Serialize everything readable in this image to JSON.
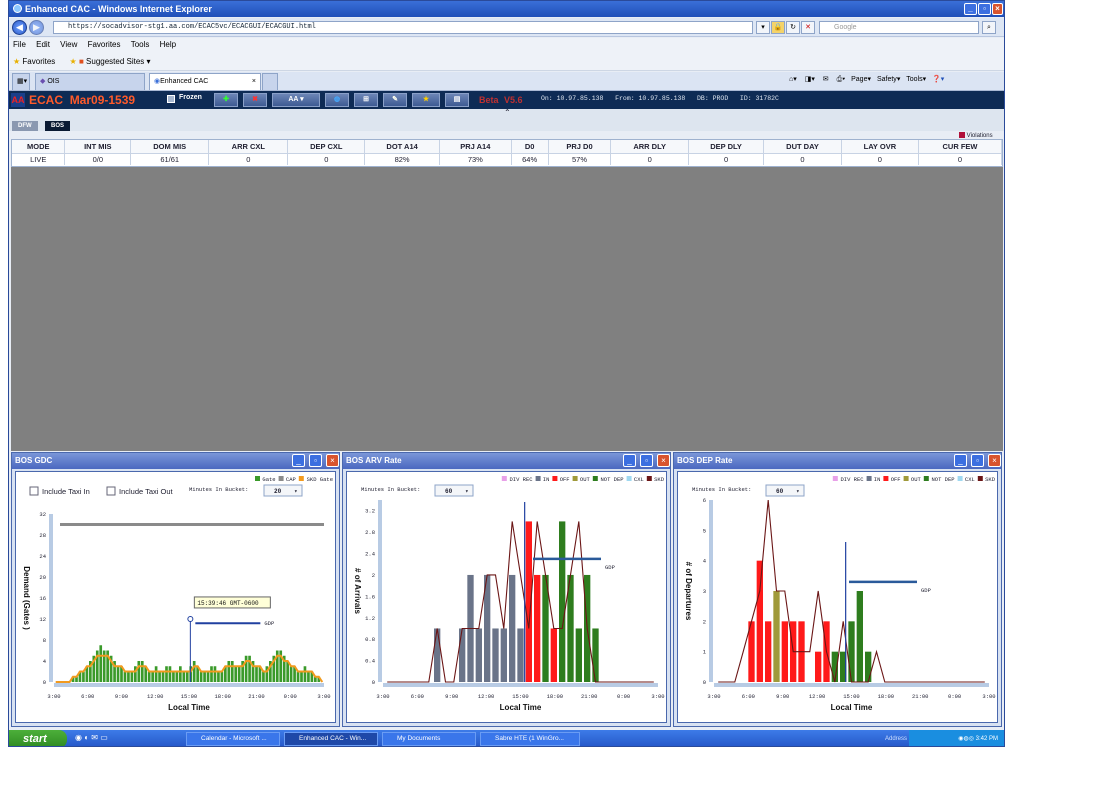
{
  "window": {
    "title": "Enhanced CAC - Windows Internet Explorer"
  },
  "browser": {
    "url": "https://socadvisor-stg1.aa.com/ECAC5vc/ECACGUI/ECACGUI.html",
    "search_placeholder": "Google",
    "menu": [
      "File",
      "Edit",
      "View",
      "Favorites",
      "Tools",
      "Help"
    ],
    "favorites_label": "Favorites",
    "suggested_sites_label": "Suggested Sites",
    "tabs": [
      "OIS",
      "Enhanced CAC"
    ],
    "toolbar": {
      "page": "Page",
      "safety": "Safety",
      "tools": "Tools"
    }
  },
  "app": {
    "name": "ECAC",
    "session": "Mar09-1539",
    "frozen_label": "Frozen",
    "filter_label": "AA",
    "beta_label": "Beta",
    "version": "V5.6",
    "status": "On: 10.97.85.138   From: 10.97.85.138   DB: PROD   ID: 31782C",
    "sites": [
      "DFW",
      "BOS"
    ],
    "violations_label": "Violations",
    "violations_color": "#b0103a"
  },
  "grid": {
    "headers": [
      "MODE",
      "INT MIS",
      "DOM MIS",
      "ARR CXL",
      "DEP CXL",
      "DOT A14",
      "PRJ A14",
      "D0",
      "PRJ D0",
      "ARR DLY",
      "DEP DLY",
      "DUT DAY",
      "LAY OVR",
      "CUR FEW"
    ],
    "row": [
      "LIVE",
      "0/0",
      "61/61",
      "0",
      "0",
      "82%",
      "73%",
      "64%",
      "57%",
      "0",
      "0",
      "0",
      "0",
      "0"
    ]
  },
  "panels": {
    "gdc": {
      "title": "BOS GDC",
      "include_taxi_in": "Include Taxi In",
      "include_taxi_out": "Include Taxi Out",
      "minutes_label": "Minutes In Bucket:",
      "minutes_value": "20",
      "legend": [
        "Gate",
        "CAP",
        "SKD Gate"
      ],
      "tooltip": "15:39:46 GMT-0600",
      "gdp_label": "GDP"
    },
    "arv": {
      "title": "BOS ARV Rate",
      "minutes_label": "Minutes In Bucket:",
      "minutes_value": "60",
      "legend": [
        "DIV REC",
        "IN",
        "OFF",
        "OUT",
        "NOT DEP",
        "CXL",
        "SKD"
      ],
      "gdp_label": "GDP"
    },
    "dep": {
      "title": "BOS DEP Rate",
      "minutes_label": "Minutes In Bucket:",
      "minutes_value": "60",
      "legend": [
        "DIV REC",
        "IN",
        "OFF",
        "OUT",
        "NOT DEP",
        "CXL",
        "SKD"
      ],
      "gdp_label": "GDP"
    }
  },
  "legend_colors": {
    "DIV REC": "#e8a0e8",
    "IN": "#6a7489",
    "OFF": "#ff1a1a",
    "OUT": "#a09a3a",
    "NOT DEP": "#2e7d1e",
    "CXL": "#a0d8f0",
    "SKD": "#6b1616",
    "Gate": "#3a9a2a",
    "CAP": "#8a8a8a",
    "SKD Gate": "#f29a1e"
  },
  "chart_data": [
    {
      "type": "bar",
      "title": "BOS GDC",
      "xlabel": "Local Time",
      "ylabel": "Demand (Gates )",
      "x_ticks": [
        "3:00",
        "6:00",
        "9:00",
        "12:00",
        "15:00",
        "18:00",
        "21:00",
        "0:00",
        "3:00"
      ],
      "ylim": [
        0,
        32
      ],
      "y_ticks": [
        0,
        4,
        8,
        12,
        16,
        20,
        24,
        28,
        32
      ],
      "series": [
        {
          "name": "Gate",
          "kind": "bar",
          "values": [
            0,
            0,
            0,
            0,
            0,
            1,
            1,
            2,
            2,
            3,
            4,
            5,
            6,
            7,
            6,
            6,
            5,
            4,
            3,
            3,
            2,
            2,
            2,
            3,
            4,
            4,
            3,
            2,
            2,
            3,
            2,
            2,
            3,
            3,
            2,
            2,
            3,
            2,
            2,
            3,
            4,
            3,
            2,
            2,
            2,
            3,
            3,
            2,
            2,
            3,
            4,
            4,
            3,
            3,
            4,
            5,
            5,
            4,
            3,
            3,
            2,
            3,
            4,
            5,
            6,
            6,
            5,
            4,
            3,
            3,
            2,
            2,
            3,
            2,
            2,
            1,
            1,
            0
          ]
        },
        {
          "name": "SKD Gate",
          "kind": "line",
          "values": [
            0,
            0,
            0,
            0,
            0,
            1,
            1,
            2,
            2,
            3,
            3,
            4,
            5,
            5,
            5,
            5,
            4,
            3,
            3,
            3,
            2,
            2,
            2,
            2,
            3,
            3,
            3,
            2,
            2,
            2,
            2,
            2,
            2,
            2,
            2,
            2,
            2,
            2,
            2,
            2,
            3,
            3,
            2,
            2,
            2,
            2,
            2,
            2,
            2,
            3,
            3,
            3,
            3,
            3,
            3,
            4,
            4,
            3,
            3,
            3,
            2,
            2,
            3,
            4,
            5,
            5,
            4,
            4,
            3,
            3,
            2,
            2,
            2,
            2,
            2,
            1,
            1,
            0
          ]
        },
        {
          "name": "CAP",
          "kind": "line",
          "values": [
            30,
            30
          ]
        }
      ]
    },
    {
      "type": "bar",
      "title": "BOS ARV Rate",
      "xlabel": "Local Time",
      "ylabel": "# of Arrivals",
      "x_ticks": [
        "3:00",
        "6:00",
        "9:00",
        "12:00",
        "15:00",
        "18:00",
        "21:00",
        "0:00",
        "3:00"
      ],
      "ylim": [
        0,
        3.4
      ],
      "y_ticks": [
        0,
        0.4,
        0.8,
        1.2,
        1.6,
        2,
        2.4,
        2.8,
        3.2
      ],
      "bars": [
        {
          "x": 6,
          "value": 1,
          "status": "IN"
        },
        {
          "x": 9,
          "value": 1,
          "status": "IN"
        },
        {
          "x": 10,
          "value": 2,
          "status": "IN"
        },
        {
          "x": 11,
          "value": 1,
          "status": "IN"
        },
        {
          "x": 12,
          "value": 2,
          "status": "IN"
        },
        {
          "x": 13,
          "value": 1,
          "status": "IN"
        },
        {
          "x": 14,
          "value": 1,
          "status": "IN"
        },
        {
          "x": 15,
          "value": 2,
          "status": "IN"
        },
        {
          "x": 16,
          "value": 1,
          "status": "IN"
        },
        {
          "x": 17,
          "value": 3,
          "status": "OFF"
        },
        {
          "x": 18,
          "value": 2,
          "status": "OFF"
        },
        {
          "x": 19,
          "value": 2,
          "status": "NOT DEP"
        },
        {
          "x": 20,
          "value": 1,
          "status": "OFF"
        },
        {
          "x": 21,
          "value": 3,
          "status": "NOT DEP"
        },
        {
          "x": 22,
          "value": 2,
          "status": "NOT DEP"
        },
        {
          "x": 23,
          "value": 1,
          "status": "NOT DEP"
        },
        {
          "x": 24,
          "value": 2,
          "status": "NOT DEP"
        },
        {
          "x": 25,
          "value": 1,
          "status": "NOT DEP"
        }
      ],
      "skd_line": [
        0,
        0,
        0,
        0,
        0,
        0,
        1,
        0,
        0,
        1,
        1,
        1,
        2,
        2,
        1,
        3,
        2,
        1,
        3,
        2,
        1,
        1,
        2,
        3,
        1,
        0,
        0,
        0,
        0,
        0,
        0,
        0,
        0
      ]
    },
    {
      "type": "bar",
      "title": "BOS DEP Rate",
      "xlabel": "Local Time",
      "ylabel": "# of Departures",
      "x_ticks": [
        "3:00",
        "6:00",
        "9:00",
        "12:00",
        "15:00",
        "18:00",
        "21:00",
        "0:00",
        "3:00"
      ],
      "ylim": [
        0,
        6
      ],
      "y_ticks": [
        0,
        1,
        2,
        3,
        4,
        5,
        6
      ],
      "bars": [
        {
          "x": 4,
          "value": 2,
          "status": "OFF"
        },
        {
          "x": 5,
          "value": 4,
          "status": "OFF"
        },
        {
          "x": 6,
          "value": 2,
          "status": "OFF"
        },
        {
          "x": 7,
          "value": 3,
          "status": "OUT"
        },
        {
          "x": 8,
          "value": 2,
          "status": "OFF"
        },
        {
          "x": 9,
          "value": 2,
          "status": "OFF"
        },
        {
          "x": 10,
          "value": 2,
          "status": "OFF"
        },
        {
          "x": 12,
          "value": 1,
          "status": "OFF"
        },
        {
          "x": 13,
          "value": 2,
          "status": "OFF"
        },
        {
          "x": 14,
          "value": 1,
          "status": "NOT DEP"
        },
        {
          "x": 15,
          "value": 1,
          "status": "NOT DEP"
        },
        {
          "x": 16,
          "value": 2,
          "status": "NOT DEP"
        },
        {
          "x": 17,
          "value": 3,
          "status": "NOT DEP"
        },
        {
          "x": 18,
          "value": 1,
          "status": "NOT DEP"
        }
      ],
      "skd_line": [
        0,
        0,
        0,
        1,
        2,
        3,
        6,
        3,
        3,
        1,
        1,
        1,
        3,
        1,
        0,
        2,
        0,
        0,
        0,
        1,
        0,
        0,
        0,
        0,
        0,
        0,
        0,
        0,
        0,
        0,
        0,
        0,
        0
      ]
    }
  ],
  "taskbar": {
    "start": "start",
    "items": [
      "Calendar - Microsoft ...",
      "Enhanced CAC - Win...",
      "My Documents",
      "Sabre HTE (1 WinGro..."
    ],
    "address_label": "Address",
    "clock": "3:42 PM"
  }
}
